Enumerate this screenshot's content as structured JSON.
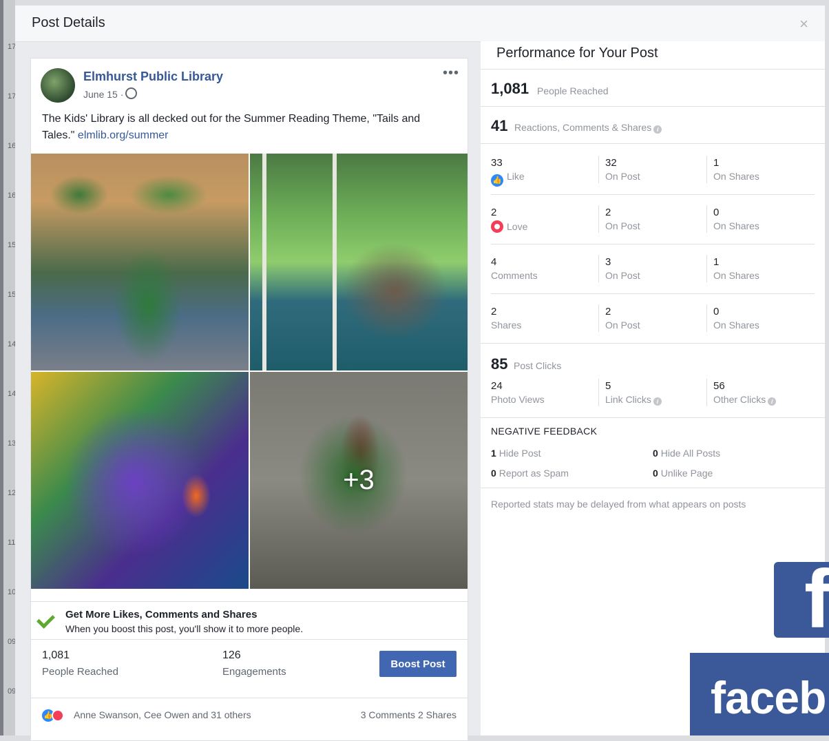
{
  "modal": {
    "title": "Post Details",
    "close": "×"
  },
  "background": {
    "labels": [
      "17",
      "17",
      "16",
      "16",
      "15",
      "15",
      "14",
      "14",
      "13",
      "12",
      "11",
      "10",
      "09",
      "09"
    ]
  },
  "post": {
    "page_name": "Elmhurst Public Library",
    "date": "June 15 ·",
    "more": "•••",
    "text": "The Kids' Library is all decked out for the Summer Reading Theme, \"Tails and Tales.\" ",
    "link": "elmlib.org/summer",
    "photo_more": "+3",
    "boost_tip": {
      "title": "Get More Likes, Comments and Shares",
      "subtitle": "When you boost this post, you'll show it to more people."
    },
    "stats": {
      "reached_num": "1,081",
      "reached_label": "People Reached",
      "engagements_num": "126",
      "engagements_label": "Engagements",
      "boost_button": "Boost Post"
    },
    "reactions": {
      "text": "Anne Swanson, Cee Owen and 31 others",
      "comments_shares": "3 Comments  2 Shares"
    }
  },
  "performance": {
    "title": "Performance for Your Post",
    "reach": {
      "num": "1,081",
      "label": "People Reached"
    },
    "engagement": {
      "num": "41",
      "label": "Reactions, Comments & Shares"
    },
    "grid": [
      {
        "a_num": "33",
        "a_label": "Like",
        "b_num": "32",
        "b_label": "On Post",
        "c_num": "1",
        "c_label": "On Shares"
      },
      {
        "a_num": "2",
        "a_label": "Love",
        "b_num": "2",
        "b_label": "On Post",
        "c_num": "0",
        "c_label": "On Shares"
      },
      {
        "a_num": "4",
        "a_label": "Comments",
        "b_num": "3",
        "b_label": "On Post",
        "c_num": "1",
        "c_label": "On Shares"
      },
      {
        "a_num": "2",
        "a_label": "Shares",
        "b_num": "2",
        "b_label": "On Post",
        "c_num": "0",
        "c_label": "On Shares"
      }
    ],
    "clicks": {
      "num": "85",
      "label": "Post Clicks",
      "photo_num": "24",
      "photo_label": "Photo Views",
      "link_num": "5",
      "link_label": "Link Clicks",
      "other_num": "56",
      "other_label": "Other Clicks"
    },
    "negative": {
      "title": "NEGATIVE FEEDBACK",
      "hide_post_num": "1",
      "hide_post_label": "Hide Post",
      "hide_all_num": "0",
      "hide_all_label": "Hide All Posts",
      "spam_num": "0",
      "spam_label": "Report as Spam",
      "unlike_num": "0",
      "unlike_label": "Unlike Page"
    },
    "disclaimer": "Reported stats may be delayed from what appears on posts"
  },
  "brand": {
    "logo_letter": "f",
    "wordmark": "faceb",
    "color": "#3b5998"
  },
  "colors": {
    "link": "#365899",
    "button": "#4267b2",
    "like": "#2d88ff",
    "love": "#f33e58",
    "check": "#5fa832"
  }
}
